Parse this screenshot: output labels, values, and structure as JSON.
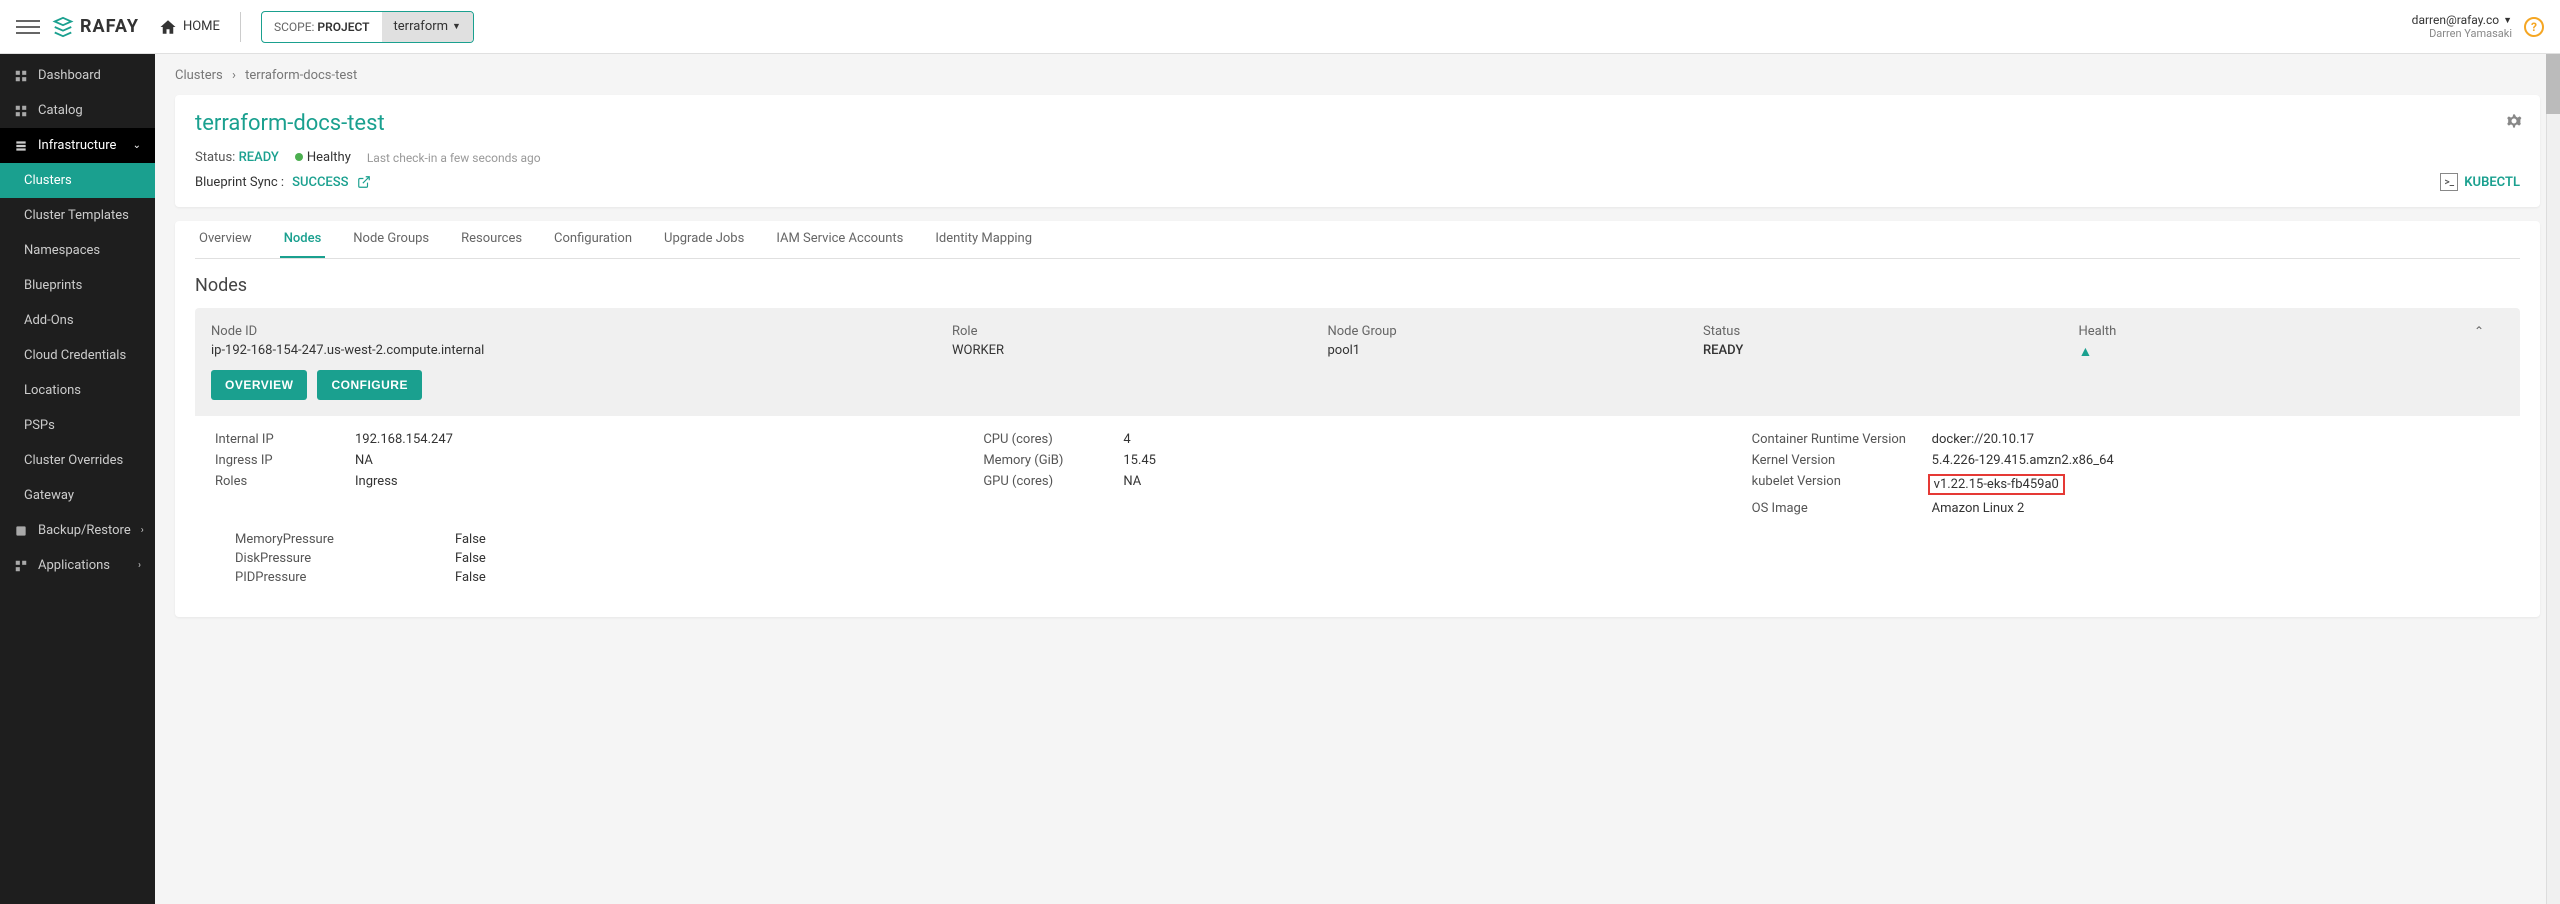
{
  "header": {
    "logo_text": "RAFAY",
    "home_label": "HOME",
    "scope_prefix": "SCOPE:",
    "scope_label": "PROJECT",
    "scope_value": "terraform",
    "user_email": "darren@rafay.co",
    "user_name": "Darren Yamasaki"
  },
  "sidebar": {
    "dashboard": "Dashboard",
    "catalog": "Catalog",
    "infrastructure": "Infrastructure",
    "subs": {
      "clusters": "Clusters",
      "cluster_templates": "Cluster Templates",
      "namespaces": "Namespaces",
      "blueprints": "Blueprints",
      "addons": "Add-Ons",
      "cloud_credentials": "Cloud Credentials",
      "locations": "Locations",
      "psps": "PSPs",
      "cluster_overrides": "Cluster Overrides",
      "gateway": "Gateway"
    },
    "backup": "Backup/Restore",
    "applications": "Applications"
  },
  "breadcrumb": {
    "root": "Clusters",
    "current": "terraform-docs-test"
  },
  "cluster": {
    "name": "terraform-docs-test",
    "status_label": "Status:",
    "status_value": "READY",
    "health_label": "Healthy",
    "checkin": "Last check-in a few seconds ago",
    "bp_label": "Blueprint Sync :",
    "bp_value": "SUCCESS",
    "kubectl": "KUBECTL"
  },
  "tabs": {
    "overview": "Overview",
    "nodes": "Nodes",
    "node_groups": "Node Groups",
    "resources": "Resources",
    "configuration": "Configuration",
    "upgrade_jobs": "Upgrade Jobs",
    "iam": "IAM Service Accounts",
    "identity": "Identity Mapping"
  },
  "section_title": "Nodes",
  "node_header": {
    "id_label": "Node ID",
    "id_value": "ip-192-168-154-247.us-west-2.compute.internal",
    "role_label": "Role",
    "role_value": "WORKER",
    "group_label": "Node Group",
    "group_value": "pool1",
    "status_label": "Status",
    "status_value": "READY",
    "health_label": "Health",
    "btn_overview": "OVERVIEW",
    "btn_configure": "CONFIGURE"
  },
  "details": {
    "col1": [
      {
        "k": "Internal IP",
        "v": "192.168.154.247"
      },
      {
        "k": "Ingress IP",
        "v": "NA"
      },
      {
        "k": "Roles",
        "v": "Ingress"
      }
    ],
    "col2": [
      {
        "k": "CPU (cores)",
        "v": "4"
      },
      {
        "k": "Memory (GiB)",
        "v": "15.45"
      },
      {
        "k": "GPU (cores)",
        "v": "NA"
      }
    ],
    "col3": [
      {
        "k": "Container Runtime Version",
        "v": "docker://20.10.17"
      },
      {
        "k": "Kernel Version",
        "v": "5.4.226-129.415.amzn2.x86_64"
      },
      {
        "k": "kubelet Version",
        "v": "v1.22.15-eks-fb459a0",
        "highlight": true
      },
      {
        "k": "OS Image",
        "v": "Amazon Linux 2"
      }
    ],
    "pressure": [
      {
        "k": "MemoryPressure",
        "v": "False"
      },
      {
        "k": "DiskPressure",
        "v": "False"
      },
      {
        "k": "PIDPressure",
        "v": "False"
      }
    ]
  }
}
